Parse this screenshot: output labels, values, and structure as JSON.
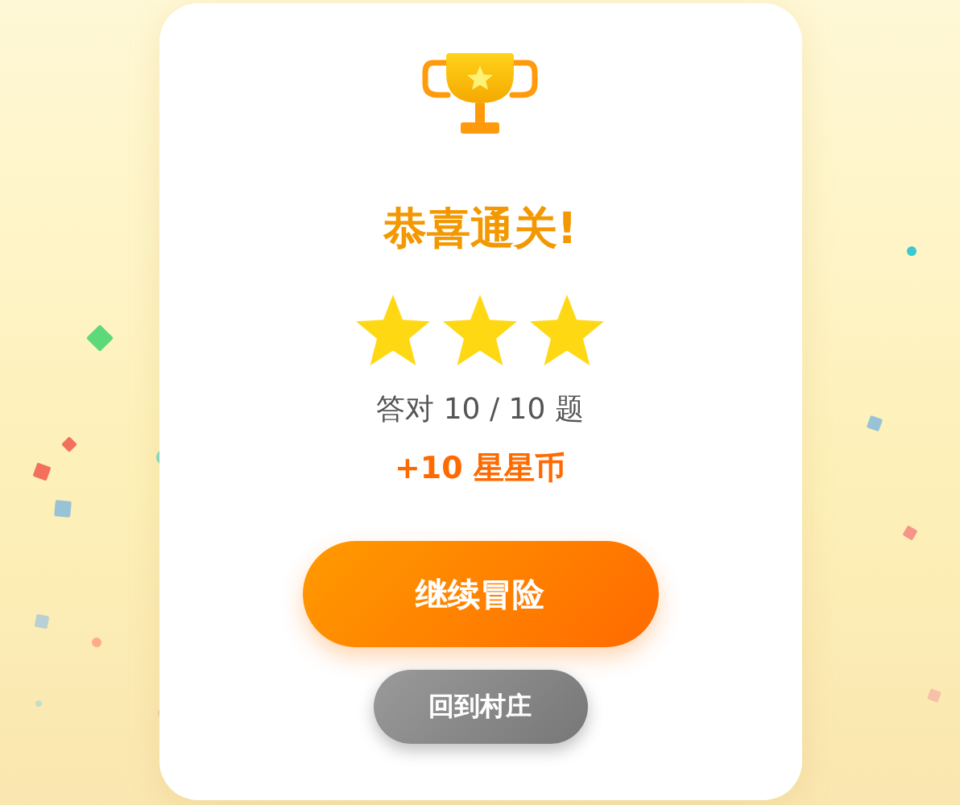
{
  "title": "恭喜通关!",
  "rating": {
    "stars": 3
  },
  "score": "答对 10 / 10 题",
  "reward": "+10 星星币",
  "buttons": [
    {
      "label": "继续冒险",
      "kind": "primary"
    },
    {
      "label": "回到村庄",
      "kind": "secondary"
    }
  ]
}
